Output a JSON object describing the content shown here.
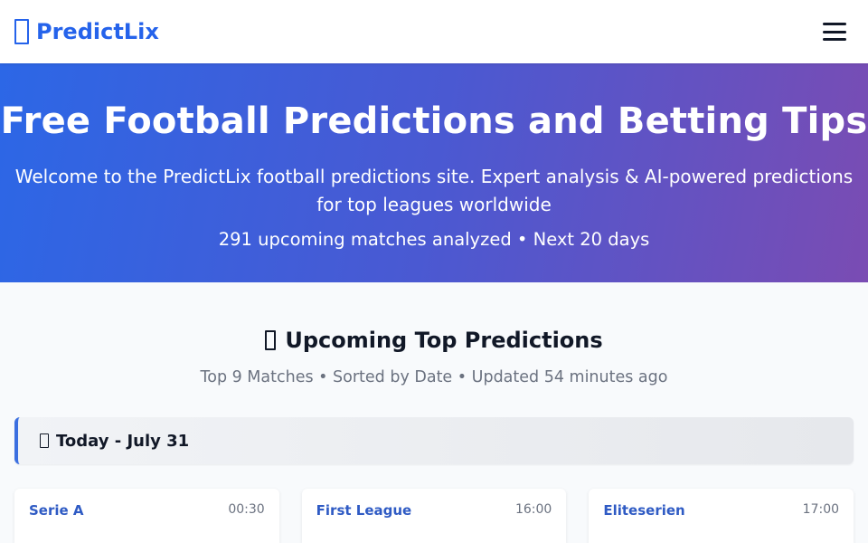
{
  "header": {
    "brand": "PredictLix",
    "brand_icon": "box-icon",
    "menu_icon": "hamburger-menu-icon"
  },
  "hero": {
    "title": "Free Football Predictions and Betting Tips",
    "lead": "Welcome to the PredictLix football predictions site. Expert analysis & AI-powered predictions for top leagues worldwide",
    "stats": "291 upcoming matches analyzed • Next 20 days"
  },
  "section": {
    "title": "Upcoming Top Predictions",
    "title_icon": "box-icon",
    "subtitle": "Top 9 Matches • Sorted by Date • Updated 54 minutes ago"
  },
  "date_group": {
    "label": "Today - July 31",
    "icon": "calendar-icon"
  },
  "matches": [
    {
      "league": "Serie A",
      "time": "00:30"
    },
    {
      "league": "First League",
      "time": "16:00"
    },
    {
      "league": "Eliteserien",
      "time": "17:00"
    }
  ],
  "colors": {
    "brand": "#2563eb",
    "hero_start": "#2c67e6",
    "hero_end": "#7a4cb3",
    "league_text": "#2f5bc4"
  }
}
